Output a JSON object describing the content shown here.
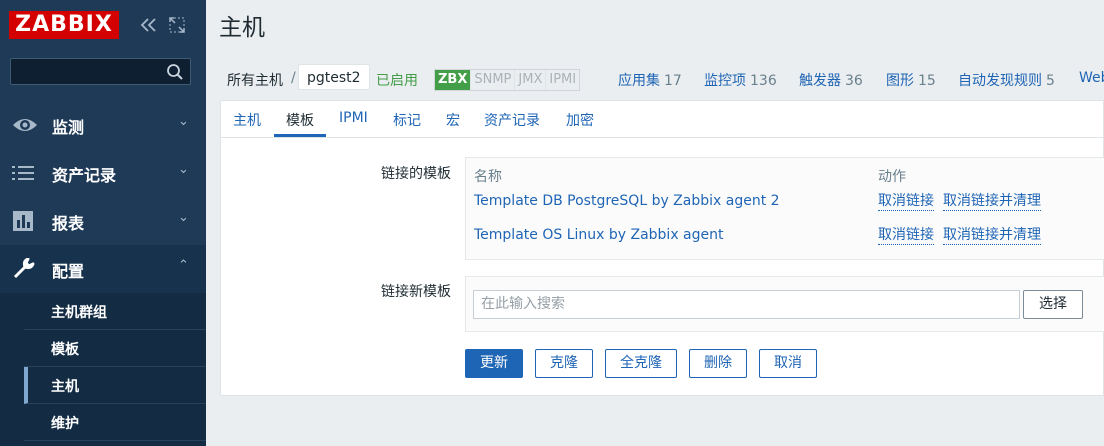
{
  "brand": {
    "logo_text": "ZABBIX",
    "color": "#d40000"
  },
  "sidebar": {
    "search_placeholder": "",
    "menu": [
      {
        "label": "监测",
        "icon": "eye-icon"
      },
      {
        "label": "资产记录",
        "icon": "list-icon"
      },
      {
        "label": "报表",
        "icon": "bar-chart-icon"
      },
      {
        "label": "配置",
        "icon": "wrench-icon"
      }
    ],
    "submenu": [
      {
        "label": "主机群组"
      },
      {
        "label": "模板"
      },
      {
        "label": "主机"
      },
      {
        "label": "维护"
      }
    ],
    "chevron_down": "⌄",
    "chevron_up": "⌃"
  },
  "page": {
    "title": "主机"
  },
  "header": {
    "breadcrumb_root": "所有主机",
    "separator": "/",
    "current_host": "pgtest2",
    "status": "已启用",
    "availability": [
      "ZBX",
      "SNMP",
      "JMX",
      "IPMI"
    ],
    "links": [
      {
        "label": "应用集",
        "count": "17"
      },
      {
        "label": "监控项",
        "count": "136"
      },
      {
        "label": "触发器",
        "count": "36"
      },
      {
        "label": "图形",
        "count": "15"
      },
      {
        "label": "自动发现规则",
        "count": "5"
      },
      {
        "label": "Web",
        "count": ""
      }
    ]
  },
  "tabs": [
    "主机",
    "模板",
    "IPMI",
    "标记",
    "宏",
    "资产记录",
    "加密"
  ],
  "form": {
    "linked_label": "链接的模板",
    "col_name": "名称",
    "col_action": "动作",
    "templates": [
      {
        "name": "Template DB PostgreSQL by Zabbix agent 2",
        "unlink": "取消链接",
        "unlink_clear": "取消链接并清理"
      },
      {
        "name": "Template OS Linux by Zabbix agent",
        "unlink": "取消链接",
        "unlink_clear": "取消链接并清理"
      }
    ],
    "new_label": "链接新模板",
    "new_placeholder": "在此输入搜索",
    "select_button": "选择"
  },
  "buttons": {
    "update": "更新",
    "clone": "克隆",
    "full_clone": "全克隆",
    "delete": "删除",
    "cancel": "取消"
  }
}
